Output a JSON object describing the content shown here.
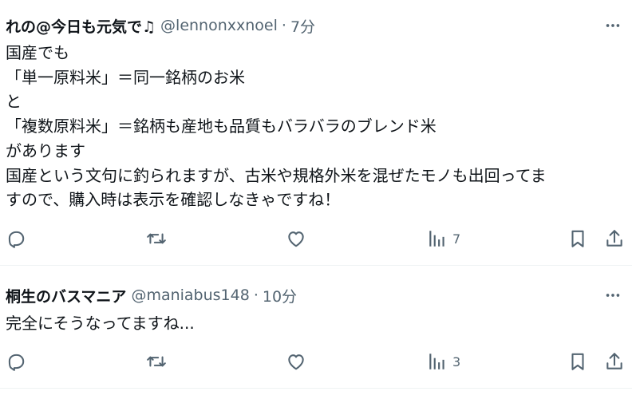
{
  "posts": [
    {
      "name": "れの@今日も元気で♫",
      "handle": "@lennonxxnoel",
      "separator": "·",
      "time": "7分",
      "lines": [
        "国産でも",
        "「単一原料米」＝同一銘柄のお米",
        "と",
        "「複数原料米」＝銘柄も産地も品質もバラバラのブレンド米",
        "があります",
        "国産という文句に釣られますが、古米や規格外米を混ぜたモノも出回ってま",
        "すので、購入時は表示を確認しなきゃですね！"
      ],
      "views": "7"
    },
    {
      "name": "桐生のバスマニア",
      "handle": "@maniabus148",
      "separator": "·",
      "time": "10分",
      "lines": [
        "完全にそうなってますね..."
      ],
      "views": "3"
    }
  ],
  "icons": {
    "more": "more-dots-icon",
    "reply": "reply-icon",
    "repost": "repost-icon",
    "like": "like-icon",
    "views": "views-icon",
    "bookmark": "bookmark-icon",
    "share": "share-icon"
  },
  "colors": {
    "text": "#0f1419",
    "secondary": "#536471",
    "divider": "#eff3f4"
  }
}
